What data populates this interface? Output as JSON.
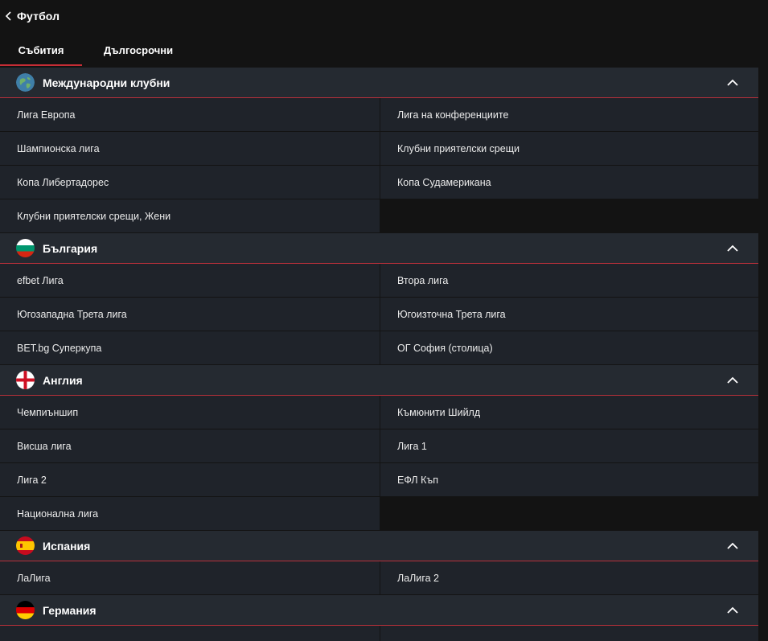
{
  "header": {
    "title": "Футбол",
    "back_icon": "chevron-left-icon"
  },
  "tabs": [
    {
      "label": "Събития",
      "active": true
    },
    {
      "label": "Дългосрочни",
      "active": false
    }
  ],
  "colors": {
    "background": "#131313",
    "section_header": "#252a31",
    "row": "#1f232a",
    "accent": "#c62d35"
  },
  "sections": [
    {
      "title": "Международни клубни",
      "icon": "globe-icon",
      "expanded": true,
      "items": [
        "Лига Европа",
        "Лига на конференциите",
        "Шампионска лига",
        "Клубни приятелски срещи",
        "Копа Либертадорес",
        "Копа Судамерикана",
        "Клубни приятелски срещи, Жени"
      ]
    },
    {
      "title": "България",
      "icon": "bulgaria-flag-icon",
      "expanded": true,
      "items": [
        "efbet Лига",
        "Втора лига",
        "Югозападна Трета лига",
        "Югоизточна Трета лига",
        "BET.bg Суперкупа",
        "ОГ София (столица)"
      ]
    },
    {
      "title": "Англия",
      "icon": "england-flag-icon",
      "expanded": true,
      "items": [
        "Чемпиъншип",
        "Къмюнити Шийлд",
        "Висша лига",
        "Лига 1",
        "Лига 2",
        "ЕФЛ Къп",
        "Национална лига"
      ]
    },
    {
      "title": "Испания",
      "icon": "spain-flag-icon",
      "expanded": true,
      "items": [
        "ЛаЛига",
        "ЛаЛига 2"
      ]
    },
    {
      "title": "Германия",
      "icon": "germany-flag-icon",
      "expanded": true,
      "items": []
    }
  ]
}
